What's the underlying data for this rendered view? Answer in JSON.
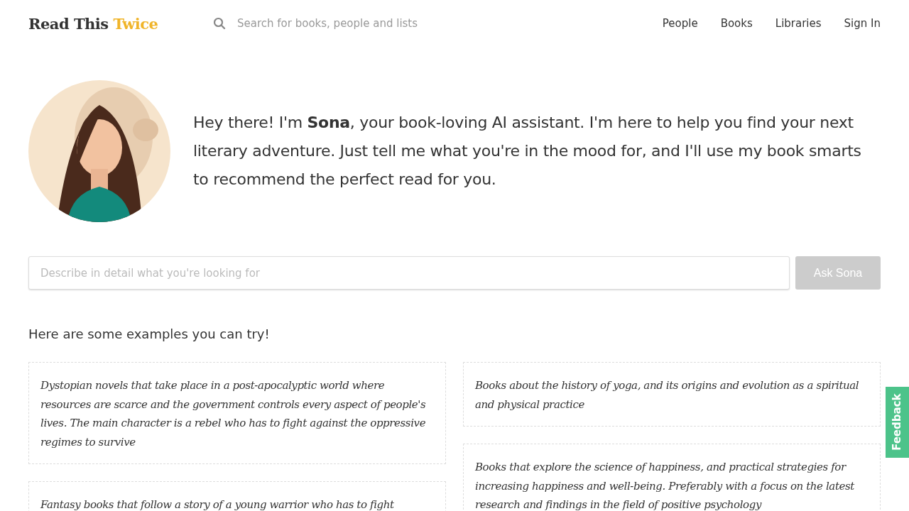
{
  "header": {
    "logo": {
      "first": "Read This",
      "second": "Twice"
    },
    "search": {
      "placeholder": "Search for books, people and lists"
    },
    "nav": [
      "People",
      "Books",
      "Libraries",
      "Sign In"
    ]
  },
  "intro": {
    "text": "Hey there! I'm **Sona**, your book-loving AI assistant. I'm here to help you find your next literary adventure. Just tell me what you're in the mood for, and I'll use my book smarts to recommend the perfect read for you."
  },
  "ask": {
    "placeholder": "Describe in detail what you're looking for",
    "button": "Ask Sona",
    "disabled": true
  },
  "examples": {
    "heading": "Here are some examples you can try!",
    "columns": [
      [
        "Dystopian novels that take place in a post-apocalyptic world where resources are scarce and the government controls every aspect of people's lives. The main character is a rebel who has to fight against the oppressive regimes to survive",
        "Fantasy books that follow a story of a young warrior who has to fight"
      ],
      [
        "Books about the history of yoga, and its origins and evolution as a spiritual and physical practice",
        "Books that explore the science of happiness, and practical strategies for increasing happiness and well-being. Preferably with a focus on the latest research and findings in the field of positive psychology"
      ]
    ]
  },
  "feedback": "Feedback"
}
